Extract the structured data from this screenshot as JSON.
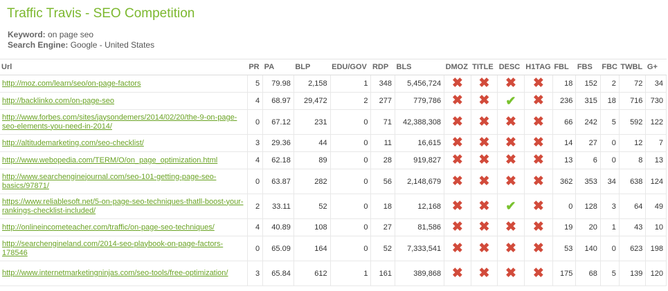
{
  "page": {
    "title": "Traffic Travis - SEO Competition",
    "keyword_label": "Keyword:",
    "keyword": "on page seo",
    "engine_label": "Search Engine:",
    "engine": "Google - United States"
  },
  "table": {
    "columns": [
      "Url",
      "PR",
      "PA",
      "BLP",
      "EDU/GOV",
      "RDP",
      "BLS",
      "DMOZ",
      "TITLE",
      "DESC",
      "H1TAG",
      "FBL",
      "FBS",
      "FBC",
      "TWBL",
      "G+"
    ],
    "rows": [
      {
        "url": "http://moz.com/learn/seo/on-page-factors",
        "pr": "5",
        "pa": "79.98",
        "blp": "2,158",
        "edu": "1",
        "rdp": "348",
        "bls": "5,456,724",
        "dmoz": "no",
        "title": "no",
        "desc": "no",
        "h1": "no",
        "fbl": "18",
        "fbs": "152",
        "fbc": "2",
        "twbl": "72",
        "gplus": "34"
      },
      {
        "url": "http://backlinko.com/on-page-seo",
        "pr": "4",
        "pa": "68.97",
        "blp": "29,472",
        "edu": "2",
        "rdp": "277",
        "bls": "779,786",
        "dmoz": "no",
        "title": "no",
        "desc": "yes",
        "h1": "no",
        "fbl": "236",
        "fbs": "315",
        "fbc": "18",
        "twbl": "716",
        "gplus": "730"
      },
      {
        "url": "http://www.forbes.com/sites/jaysondemers/2014/02/20/the-9-on-page-seo-elements-you-need-in-2014/",
        "pr": "0",
        "pa": "67.12",
        "blp": "231",
        "edu": "0",
        "rdp": "71",
        "bls": "42,388,308",
        "dmoz": "no",
        "title": "no",
        "desc": "no",
        "h1": "no",
        "fbl": "66",
        "fbs": "242",
        "fbc": "5",
        "twbl": "592",
        "gplus": "122"
      },
      {
        "url": "http://altitudemarketing.com/seo-checklist/",
        "pr": "3",
        "pa": "29.36",
        "blp": "44",
        "edu": "0",
        "rdp": "11",
        "bls": "16,615",
        "dmoz": "no",
        "title": "no",
        "desc": "no",
        "h1": "no",
        "fbl": "14",
        "fbs": "27",
        "fbc": "0",
        "twbl": "12",
        "gplus": "7"
      },
      {
        "url": "http://www.webopedia.com/TERM/O/on_page_optimization.html",
        "pr": "4",
        "pa": "62.18",
        "blp": "89",
        "edu": "0",
        "rdp": "28",
        "bls": "919,827",
        "dmoz": "no",
        "title": "no",
        "desc": "no",
        "h1": "no",
        "fbl": "13",
        "fbs": "6",
        "fbc": "0",
        "twbl": "8",
        "gplus": "13"
      },
      {
        "url": "http://www.searchenginejournal.com/seo-101-getting-page-seo-basics/97871/",
        "pr": "0",
        "pa": "63.87",
        "blp": "282",
        "edu": "0",
        "rdp": "56",
        "bls": "2,148,679",
        "dmoz": "no",
        "title": "no",
        "desc": "no",
        "h1": "no",
        "fbl": "362",
        "fbs": "353",
        "fbc": "34",
        "twbl": "638",
        "gplus": "124"
      },
      {
        "url": "https://www.reliablesoft.net/5-on-page-seo-techniques-thatll-boost-your-rankings-checklist-included/",
        "pr": "2",
        "pa": "33.11",
        "blp": "52",
        "edu": "0",
        "rdp": "18",
        "bls": "12,168",
        "dmoz": "no",
        "title": "no",
        "desc": "yes",
        "h1": "no",
        "fbl": "0",
        "fbs": "128",
        "fbc": "3",
        "twbl": "64",
        "gplus": "49"
      },
      {
        "url": "http://onlineincometeacher.com/traffic/on-page-seo-techniques/",
        "pr": "4",
        "pa": "40.89",
        "blp": "108",
        "edu": "0",
        "rdp": "27",
        "bls": "81,586",
        "dmoz": "no",
        "title": "no",
        "desc": "no",
        "h1": "no",
        "fbl": "19",
        "fbs": "20",
        "fbc": "1",
        "twbl": "43",
        "gplus": "10"
      },
      {
        "url": "http://searchengineland.com/2014-seo-playbook-on-page-factors-178546",
        "pr": "0",
        "pa": "65.09",
        "blp": "164",
        "edu": "0",
        "rdp": "52",
        "bls": "7,333,541",
        "dmoz": "no",
        "title": "no",
        "desc": "no",
        "h1": "no",
        "fbl": "53",
        "fbs": "140",
        "fbc": "0",
        "twbl": "623",
        "gplus": "198"
      },
      {
        "url": "http://www.internetmarketingninjas.com/seo-tools/free-optimization/",
        "pr": "3",
        "pa": "65.84",
        "blp": "612",
        "edu": "1",
        "rdp": "161",
        "bls": "389,868",
        "dmoz": "no",
        "title": "no",
        "desc": "no",
        "h1": "no",
        "fbl": "175",
        "fbs": "68",
        "fbc": "5",
        "twbl": "139",
        "gplus": "120"
      }
    ]
  }
}
